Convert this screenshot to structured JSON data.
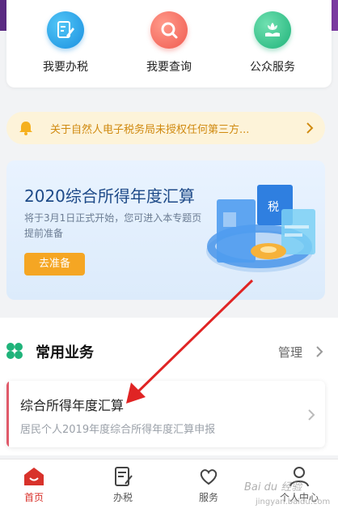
{
  "services": [
    {
      "label": "我要办税",
      "icon": "pen-document-icon",
      "color": "#1a8fe0"
    },
    {
      "label": "我要查询",
      "icon": "magnifier-icon",
      "color": "#f05a50"
    },
    {
      "label": "公众服务",
      "icon": "hand-flower-icon",
      "color": "#1fb37a"
    }
  ],
  "notice": {
    "text": "关于自然人电子税务局未授权任何第三方...",
    "icon": "bell-icon"
  },
  "promo": {
    "title": "2020综合所得年度汇算",
    "desc": "将于3月1日正式开始，您可进入本专题页提前准备",
    "button": "去准备",
    "illus_label": "税"
  },
  "common": {
    "title": "常用业务",
    "manage": "管理"
  },
  "business": {
    "title": "综合所得年度汇算",
    "subtitle": "居民个人2019年度综合所得年度汇算申报"
  },
  "tabs": [
    {
      "label": "首页",
      "icon": "home-icon",
      "active": true
    },
    {
      "label": "办税",
      "icon": "tax-form-icon",
      "active": false
    },
    {
      "label": "服务",
      "icon": "heart-hands-icon",
      "active": false
    },
    {
      "label": "个人中心",
      "icon": "person-icon",
      "active": false
    }
  ],
  "watermark": {
    "line1": "Bai du 经验",
    "line2": "jingyan.baidu.com"
  },
  "colors": {
    "accent": "#d8322b",
    "notice_text": "#d08a10",
    "promo_button": "#f5a623",
    "purple_band": "#6a2f90"
  }
}
